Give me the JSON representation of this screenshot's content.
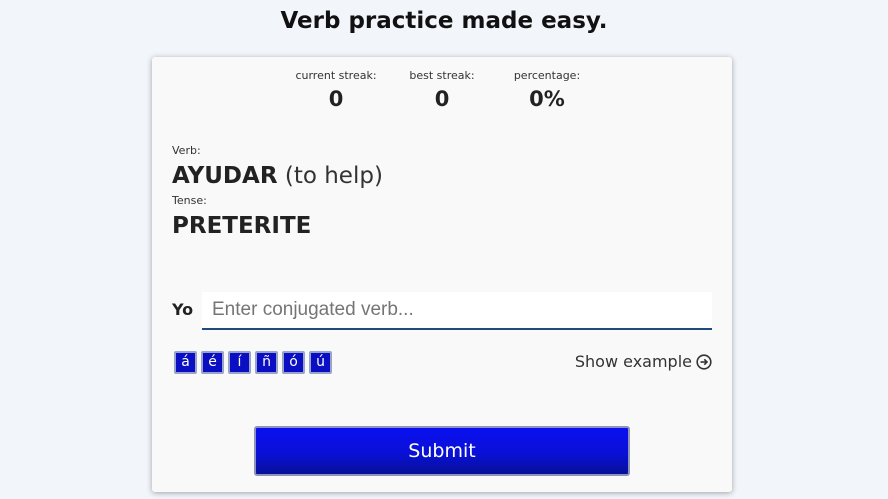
{
  "page": {
    "title": "Verb practice made easy."
  },
  "stats": {
    "current_streak_label": "current streak:",
    "current_streak_value": "0",
    "best_streak_label": "best streak:",
    "best_streak_value": "0",
    "percentage_label": "percentage:",
    "percentage_value": "0%"
  },
  "verb": {
    "label": "Verb:",
    "name": "AYUDAR",
    "translation": "(to help)"
  },
  "tense": {
    "label": "Tense:",
    "value": "PRETERITE"
  },
  "answer": {
    "pronoun": "Yo",
    "value": "",
    "placeholder": "Enter conjugated verb..."
  },
  "accents": [
    "á",
    "é",
    "í",
    "ñ",
    "ó",
    "ú"
  ],
  "show_example": {
    "label": "Show example",
    "icon": "arrow-right-circle-icon"
  },
  "submit": {
    "label": "Submit"
  },
  "colors": {
    "background": "#f2f6fb",
    "card": "#f9f9f9",
    "accent_blue": "#0a10f0",
    "input_underline": "#1f4c7a"
  }
}
